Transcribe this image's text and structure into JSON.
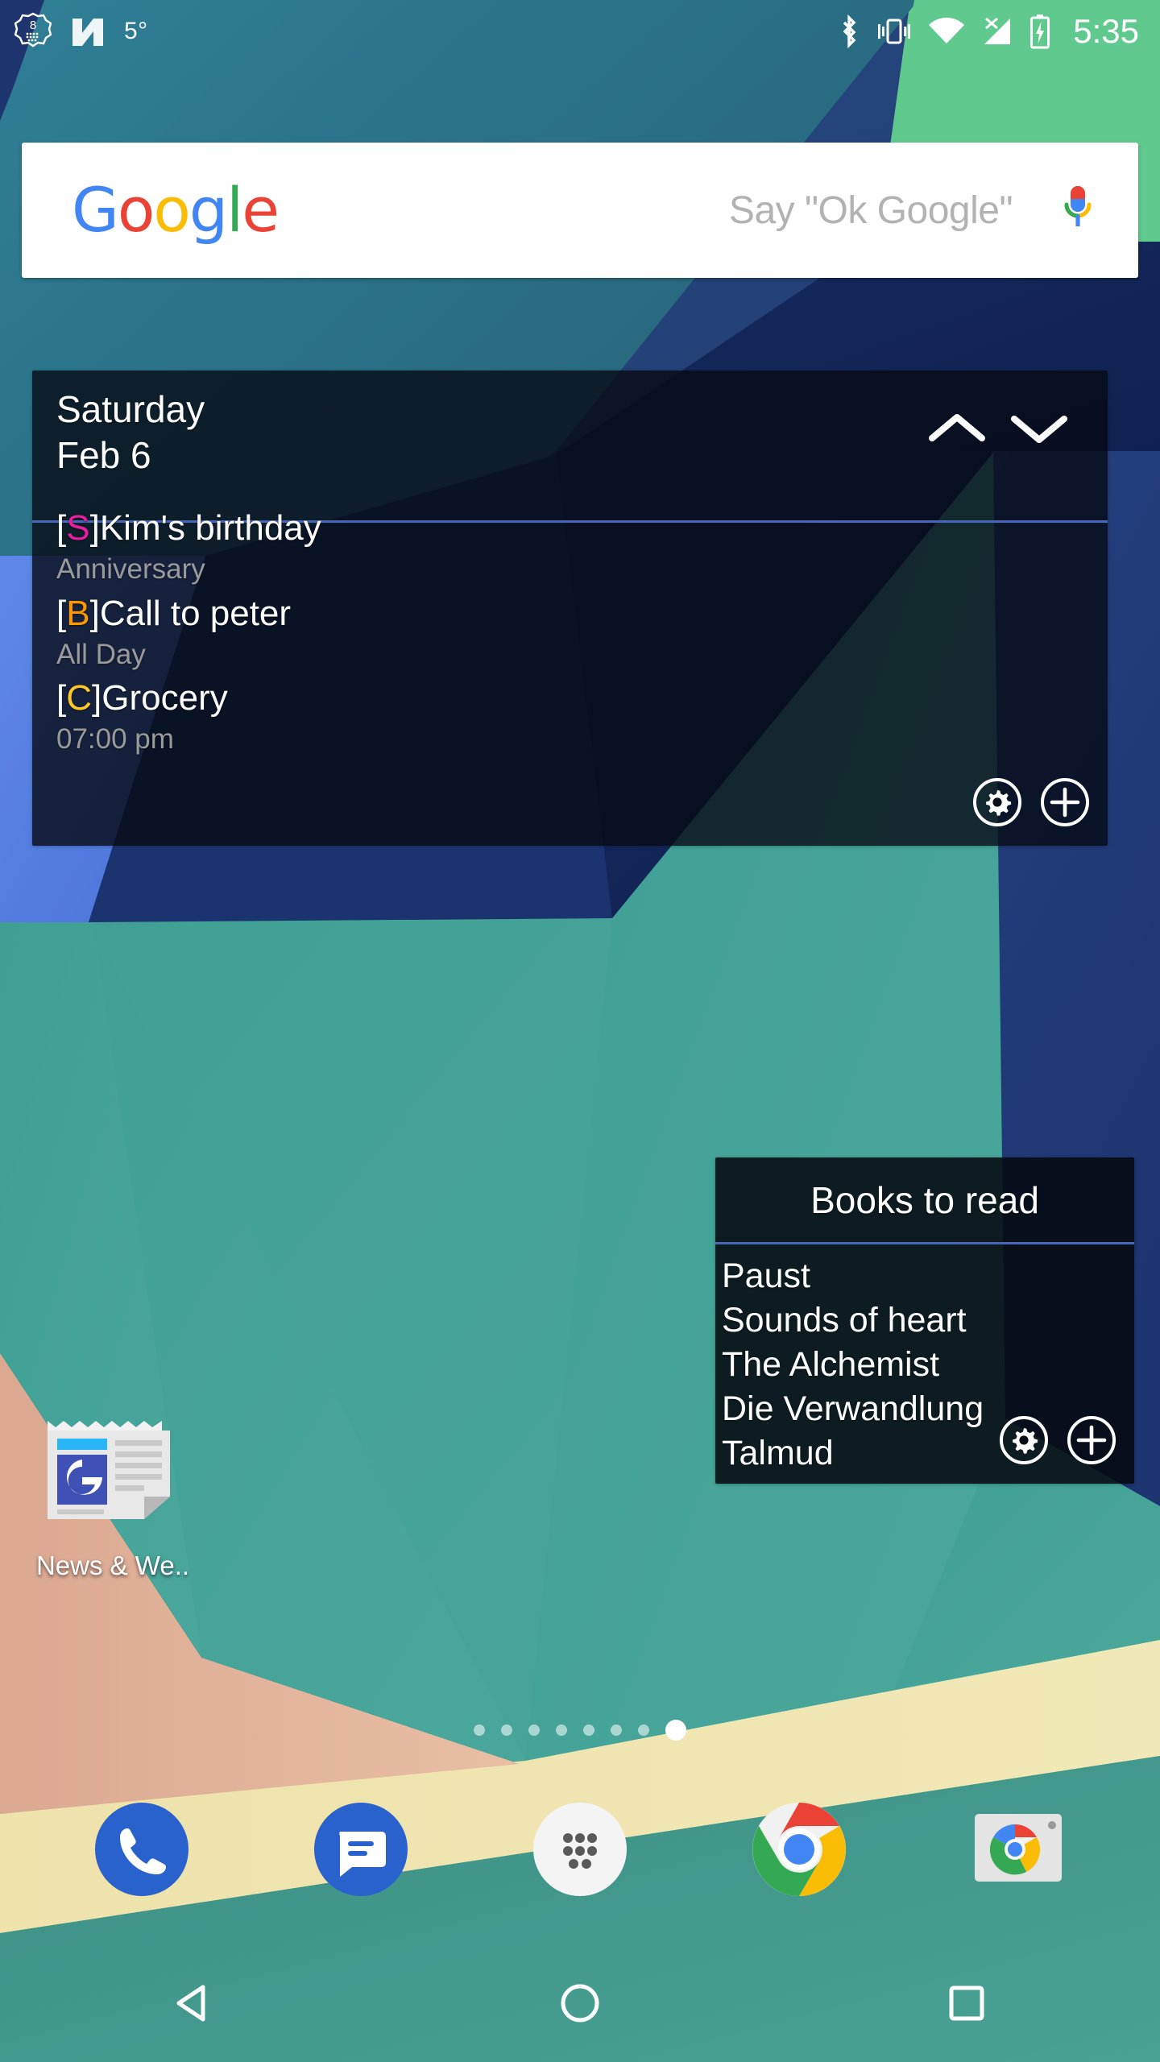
{
  "status_bar": {
    "left_icons": [
      {
        "name": "app-badge-8-icon",
        "label": "8"
      },
      {
        "name": "android-n-logo-icon",
        "label": "N"
      }
    ],
    "temperature": "5°",
    "right_icons": [
      {
        "name": "bluetooth-icon"
      },
      {
        "name": "vibrate-icon"
      },
      {
        "name": "wifi-icon"
      },
      {
        "name": "cellular-no-signal-icon"
      },
      {
        "name": "battery-charging-icon"
      }
    ],
    "clock": "5:35"
  },
  "search": {
    "logo_letters": [
      {
        "char": "G",
        "color": "#4285f4"
      },
      {
        "char": "o",
        "color": "#ea4335"
      },
      {
        "char": "o",
        "color": "#fbbc05"
      },
      {
        "char": "g",
        "color": "#4285f4"
      },
      {
        "char": "l",
        "color": "#34a853"
      },
      {
        "char": "e",
        "color": "#ea4335"
      }
    ],
    "logo_text": "Google",
    "hint": "Say \"Ok Google\"",
    "mic_icon": "microphone-icon"
  },
  "calendar_widget": {
    "day": "Saturday",
    "date": "Feb 6",
    "prev_icon": "chevron-up-icon",
    "next_icon": "chevron-down-icon",
    "settings_icon": "gear-icon",
    "add_icon": "plus-circle-icon",
    "accent_color": "#4a66b8",
    "events": [
      {
        "tag": "S",
        "tag_color": "#e91e9e",
        "title": "Kim's birthday",
        "sub": "Anniversary"
      },
      {
        "tag": "B",
        "tag_color": "#ff9800",
        "title": "Call to peter",
        "sub": "All Day"
      },
      {
        "tag": "C",
        "tag_color": "#ffc727",
        "title": "Grocery",
        "sub": "07:00 pm"
      }
    ]
  },
  "books_widget": {
    "title": "Books to read",
    "settings_icon": "gear-icon",
    "add_icon": "plus-circle-icon",
    "accent_color": "#4a66b8",
    "items": [
      "Paust",
      "Sounds of heart",
      "The Alchemist",
      "Die Verwandlung",
      "Talmud"
    ]
  },
  "home_icons": [
    {
      "name": "news-and-weather-icon",
      "label": "News & We.."
    }
  ],
  "page_indicator": {
    "total": 8,
    "active_index": 7
  },
  "dock": [
    {
      "name": "phone-icon",
      "label": "Phone"
    },
    {
      "name": "messages-icon",
      "label": "Messages"
    },
    {
      "name": "app-drawer-icon",
      "label": "All apps"
    },
    {
      "name": "chrome-icon",
      "label": "Chrome"
    },
    {
      "name": "camera-icon",
      "label": "Camera"
    }
  ],
  "nav_bar": [
    {
      "name": "back-button",
      "label": "Back"
    },
    {
      "name": "home-button",
      "label": "Home"
    },
    {
      "name": "recents-button",
      "label": "Recents"
    }
  ]
}
